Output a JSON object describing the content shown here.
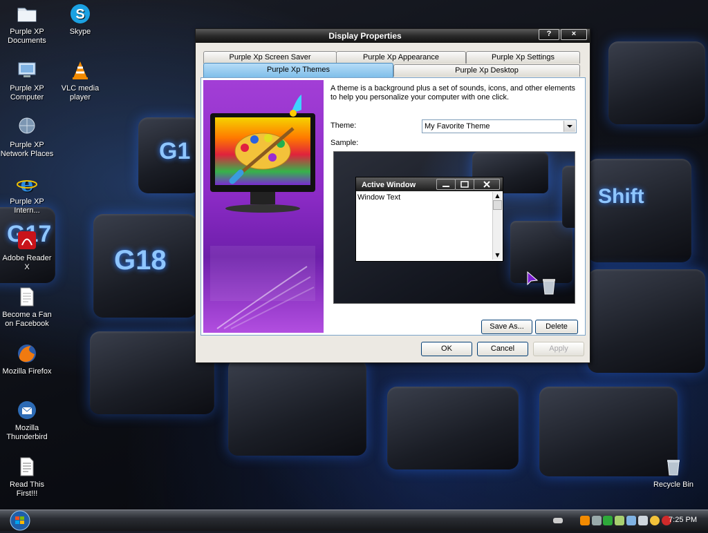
{
  "desktop": {
    "icons": [
      {
        "label": "Purple XP Documents",
        "icon": "folder-icon"
      },
      {
        "label": "Skype",
        "icon": "skype-icon"
      },
      {
        "label": "Purple XP Computer",
        "icon": "computer-icon"
      },
      {
        "label": "VLC media player",
        "icon": "vlc-icon"
      },
      {
        "label": "Purple XP Network Places",
        "icon": "network-icon"
      },
      {
        "label": "Purple XP Intern...",
        "icon": "internet-explorer-icon"
      },
      {
        "label": "Adobe Reader X",
        "icon": "adobe-reader-icon"
      },
      {
        "label": "Become a Fan on Facebook",
        "icon": "document-icon"
      },
      {
        "label": "Mozilla Firefox",
        "icon": "firefox-icon"
      },
      {
        "label": "Mozilla Thunderbird",
        "icon": "thunderbird-icon"
      },
      {
        "label": "Read This First!!!",
        "icon": "text-file-icon"
      },
      {
        "label": "Recycle Bin",
        "icon": "recycle-bin-icon"
      }
    ],
    "keys": [
      "G17",
      "G18",
      "G1",
      "Shift"
    ]
  },
  "dialog": {
    "title": "Display Properties",
    "help_label": "?",
    "close_label": "×",
    "tabs_row1": [
      "Purple Xp Screen Saver",
      "Purple Xp Appearance",
      "Purple Xp Settings"
    ],
    "tabs_row2": [
      "Purple Xp Themes",
      "Purple Xp Desktop"
    ],
    "active_tab": "Purple Xp Themes",
    "description": "A theme is a background plus a set of sounds, icons, and other elements to help you personalize your computer with one click.",
    "theme_label": "Theme:",
    "theme_value": "My Favorite Theme",
    "sample_label": "Sample:",
    "sample_window": {
      "title": "Active Window",
      "text": "Window Text"
    },
    "save_as_label": "Save As...",
    "delete_label": "Delete",
    "ok_label": "OK",
    "cancel_label": "Cancel",
    "apply_label": "Apply",
    "colors": {
      "purple": "#9a35d0",
      "accent": "#7cbde9"
    }
  },
  "taskbar": {
    "clock": "7:25 PM"
  }
}
